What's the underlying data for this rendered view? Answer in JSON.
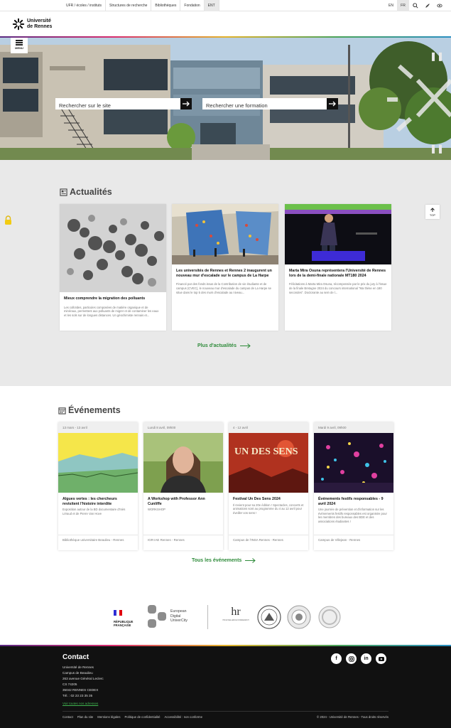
{
  "topbar": {
    "links": [
      "UFR / écoles / instituts",
      "Structures de recherche",
      "Bibliothèques",
      "Fondation",
      "ENT"
    ],
    "lang_en": "EN",
    "lang_fr": "FR"
  },
  "header": {
    "logo_line1": "Université",
    "logo_line2": "de Rennes"
  },
  "menu": {
    "label": "MENU"
  },
  "search": {
    "site_placeholder": "Rechercher sur le site",
    "formation_placeholder": "Rechercher une formation"
  },
  "news": {
    "title": "Actualités",
    "cards": [
      {
        "title": "Mieux comprendre la migration des polluants",
        "text": "Les colloïdes, particules composées de matière organique et de minéraux, permettent aux polluants de migrer et de contaminer les eaux et les sols sur de longues distances. Un géochimiste rennais et..."
      },
      {
        "title": "Les universités de Rennes et Rennes 2 inaugurent un nouveau mur d'escalade sur le campus de La Harpe",
        "text": "Financé par des fonds issus de la Contribution de vie étudiante et de campus (CVEC), le nouveau mur d'escalade du campus de La Harpe se situe dans le top 5 des murs d'escalade au niveau..."
      },
      {
        "title": "Marta Mira Osuna représentera l'Université de Rennes lors de la demi-finale nationale MT180 2024",
        "text": "Félicitations à Marta Mira Osuna, récompensée par le prix du jury à l'issue de la finale Bretagne 2024 du concours international \"Ma thèse en 180 secondes\". Doctorante au sein de l..."
      }
    ],
    "more": "Plus d'actualités"
  },
  "scroll_top": {
    "label": "TOP"
  },
  "events": {
    "title": "Événements",
    "cards": [
      {
        "date": "13 mars - 13 avril",
        "title": "Algues vertes : les chercheurs revisitent l'histoire interdite",
        "text": "Exposition autour de la BD documentaire d'Inès Léraud et de Pierre Van Hove",
        "place": "Bibliothèque universitaire Beaulieu - Rennes"
      },
      {
        "date": "Lundi 8 avril, 09h00",
        "title": "A Workshop with Professor Ann Cunliffe",
        "text": "WORKSHOP",
        "place": "IGR-IAE Rennes - Rennes"
      },
      {
        "date": "4 - 12 avril",
        "title": "Festival Un Des Sens 2024",
        "text": "Il revient pour sa 20e édition ! Spectacles, concerts et animations sont au programme du 4 au 12 avril pour éveiller vos sens !",
        "place": "Campus de l'INSA Rennes - Rennes"
      },
      {
        "date": "Mardi 9 avril, 09h00",
        "title": "Événements festifs responsables - 9 avril 2024",
        "text": "Une journée de prévention et d'information sur les événements festifs responsables est organisée pour les membres des bureaux des BDE et des associations étudiantes !",
        "place": "Campus de Villejean - Rennes"
      }
    ],
    "more": "Tous les événements",
    "poster_text": "UN DES SENS"
  },
  "partners": {
    "republique": "RÉPUBLIQUE FRANÇAISE",
    "eduuc_line1": "European",
    "eduuc_line2": "Digital",
    "eduuc_line3": "UniverCity",
    "hr": "hr",
    "hr_sub": "HR EXCELLENCE IN RESEARCH"
  },
  "footer": {
    "title": "Contact",
    "address": [
      "Université de Rennes",
      "Campus de Beaulieu",
      "263 avenue Général Leclerc",
      "CS 74205",
      "35042 RENNES CEDEX",
      "Tél. : 02 23 23 35 35"
    ],
    "all_addresses": "Voir toutes nos adresses",
    "links": [
      "Contact",
      "Plan du site",
      "Mentions légales",
      "Politique de confidentialité",
      "Accessibilité : non conforme"
    ],
    "copyright": "© 2024 - Université de Rennes - Tous droits réservés"
  },
  "colors": {
    "accent_green": "#2e8b3a",
    "footer_bg": "#111111",
    "news_bg": "#e9e9e9"
  }
}
